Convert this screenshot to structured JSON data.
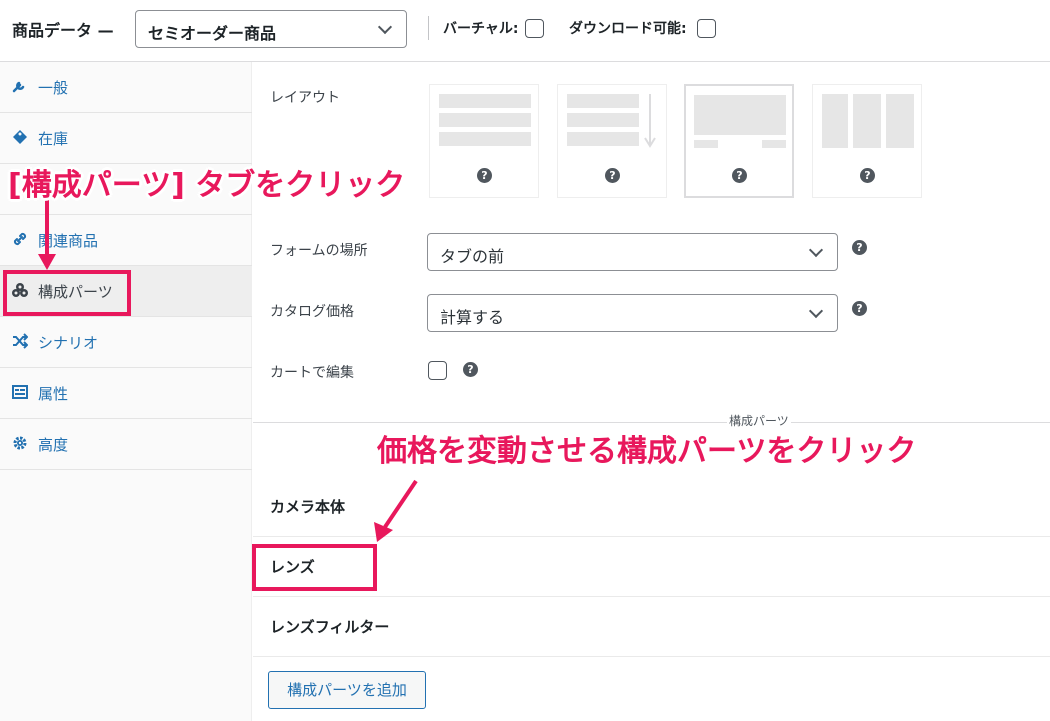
{
  "header": {
    "title": "商品データ —",
    "product_type": "セミオーダー商品",
    "virtual_label": "バーチャル:",
    "downloadable_label": "ダウンロード可能:"
  },
  "sidebar": {
    "items": [
      {
        "label": "一般",
        "icon": "wrench-icon"
      },
      {
        "label": "在庫",
        "icon": "tag-icon"
      },
      {
        "label": "",
        "icon": "truck-icon"
      },
      {
        "label": "関連商品",
        "icon": "link-icon"
      },
      {
        "label": "構成パーツ",
        "icon": "components-icon"
      },
      {
        "label": "シナリオ",
        "icon": "shuffle-icon"
      },
      {
        "label": "属性",
        "icon": "list-icon"
      },
      {
        "label": "高度",
        "icon": "gear-icon"
      }
    ]
  },
  "main": {
    "layout_label": "レイアウト",
    "form_location_label": "フォームの場所",
    "form_location_value": "タブの前",
    "catalog_price_label": "カタログ価格",
    "catalog_price_value": "計算する",
    "edit_in_cart_label": "カートで編集",
    "components_caption": "構成パーツ",
    "components": [
      "カメラ本体",
      "レンズ",
      "レンズフィルター"
    ],
    "add_button": "構成パーツを追加",
    "help_glyph": "?"
  },
  "annotations": {
    "tab_instruction": "[構成パーツ] タブをクリック",
    "component_instruction": "価格を変動させる構成パーツをクリック"
  },
  "colors": {
    "accent": "#e8185c",
    "link": "#2271b1"
  }
}
